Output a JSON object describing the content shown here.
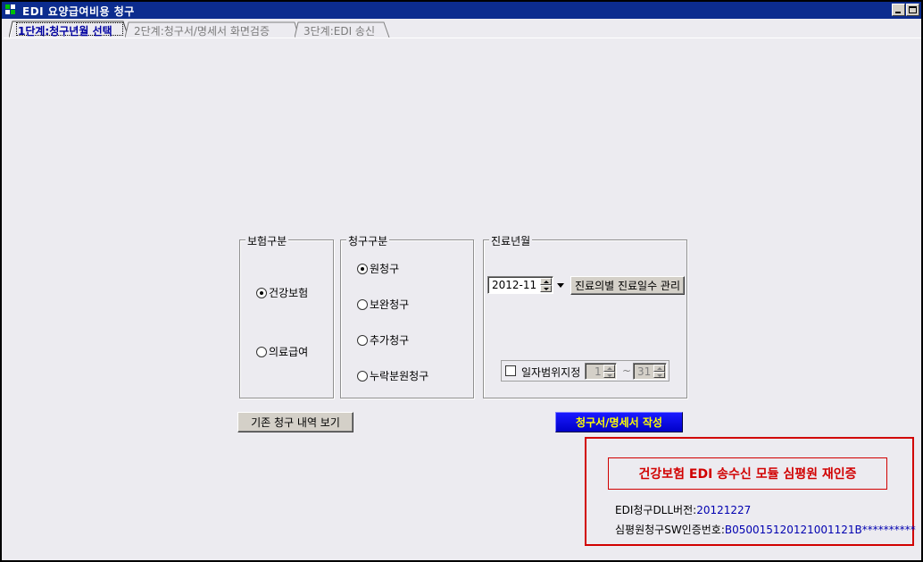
{
  "window": {
    "title": "EDI 요양급여비용 청구"
  },
  "tabs": [
    {
      "label": "1단계:청구년월 선택"
    },
    {
      "label": "2단계:청구서/명세서  화면검증"
    },
    {
      "label": "3단계:EDI 송신"
    }
  ],
  "insurance_group": {
    "title": "보험구분",
    "options": [
      {
        "label": "건강보험",
        "selected": true
      },
      {
        "label": "의료급여",
        "selected": false
      }
    ]
  },
  "claim_group": {
    "title": "청구구분",
    "options": [
      {
        "label": "원청구",
        "selected": true
      },
      {
        "label": "보완청구",
        "selected": false
      },
      {
        "label": "추가청구",
        "selected": false
      },
      {
        "label": "누락분원청구",
        "selected": false
      }
    ]
  },
  "period_group": {
    "title": "진료년월",
    "month_value": "2012-11",
    "manage_button": "진료의별 진료일수 관리",
    "range_checkbox_label": "일자범위지정",
    "range_checked": false,
    "range_from": "1",
    "range_sep": "~",
    "range_to": "31"
  },
  "buttons": {
    "history": "기존 청구 내역 보기",
    "create": "청구서/명세서 작성"
  },
  "notice": {
    "headline": "건강보험 EDI 송수신 모듈 심평원 재인증",
    "dll_label": "EDI청구DLL버전:",
    "dll_value": "20121227",
    "cert_label": "심평원청구SW인증번호:",
    "cert_value": "B050015120121001121B**********"
  },
  "colors": {
    "title_bar": "#0c2c8e",
    "active_tab_text": "#0000a0",
    "notice_red": "#d10000",
    "create_button": "#0000e0",
    "create_button_text": "#ffff00",
    "value_blue": "#0000b0"
  }
}
